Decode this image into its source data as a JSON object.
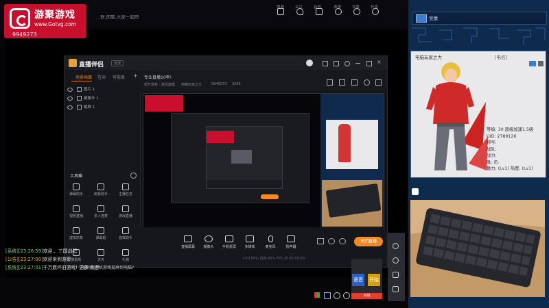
{
  "logo": {
    "title": "游聚游戏",
    "url": "www.Gotvg.com"
  },
  "room_id": "9949273",
  "marquee": "...联,团聚,大家一起吧",
  "top_icons": [
    {
      "icon": "window-icon",
      "label": "换屏"
    },
    {
      "icon": "heart-icon",
      "label": "关注"
    },
    {
      "icon": "volume-icon",
      "label": "音效"
    },
    {
      "icon": "smile-icon",
      "label": "表情"
    },
    {
      "icon": "gear-icon",
      "label": "设置"
    },
    {
      "icon": "timer-icon",
      "label": "托盘"
    }
  ],
  "obs": {
    "app_name": "直播伴侣",
    "badge": "省流",
    "tabs": [
      "场景画面",
      "互动",
      "可能发"
    ],
    "scenes": [
      "图片 1",
      "摄像头 1",
      "截屏 1"
    ],
    "tools_label": "工具箱",
    "tools": [
      "弹幕助手",
      "房管助手",
      "主播任务",
      "视频直播",
      "多人连麦",
      "游戏直播",
      "虚拟形象",
      "弹幕姬",
      "音效助手",
      "鼓励师",
      "天天",
      "礼物"
    ],
    "stream_title": "专业直播10年!",
    "category": "拆开游戏 · 游戏直播",
    "stream_meta": [
      "电脑玩家之大",
      "9949273",
      "3285"
    ],
    "controls": [
      "直播屏幕",
      "摄像头",
      "手机投屏",
      "多媒体",
      "麦克风",
      "扬声器"
    ],
    "start_button": "关闭直播",
    "status": "CPU 80%  内存 45%  FPS 30  00:00:00"
  },
  "chat": [
    {
      "tag": "[系统][23:26:59]",
      "text": "欢迎... 三国战纪"
    },
    {
      "tag": "[公告][23:27:00]",
      "text": "欢迎来到游聚"
    },
    {
      "tag": "[系统][23:27:01]",
      "text": "千万数坏旧游戏! 更多 欢迎"
    }
  ],
  "notice": "如何把手机游戏投屏到电脑?",
  "side_buttons": [
    "语音",
    "开始",
    "对战"
  ],
  "right_panel": {
    "header": "竞猜",
    "character_name": "电脑玩家之大",
    "server": "[电信]",
    "info": [
      "等级: 30  超级加速1.5级",
      "UID: 2789126",
      "称号:",
      "战队:",
      "战力:",
      "胜: 负:",
      "魅力: (Lv1)  热度: (Lv1)"
    ]
  },
  "colors": {
    "accent": "#f08a24",
    "logo_red": "#c8102e",
    "panel_blue": "#0e2a4c",
    "send_red": "#e04030"
  }
}
